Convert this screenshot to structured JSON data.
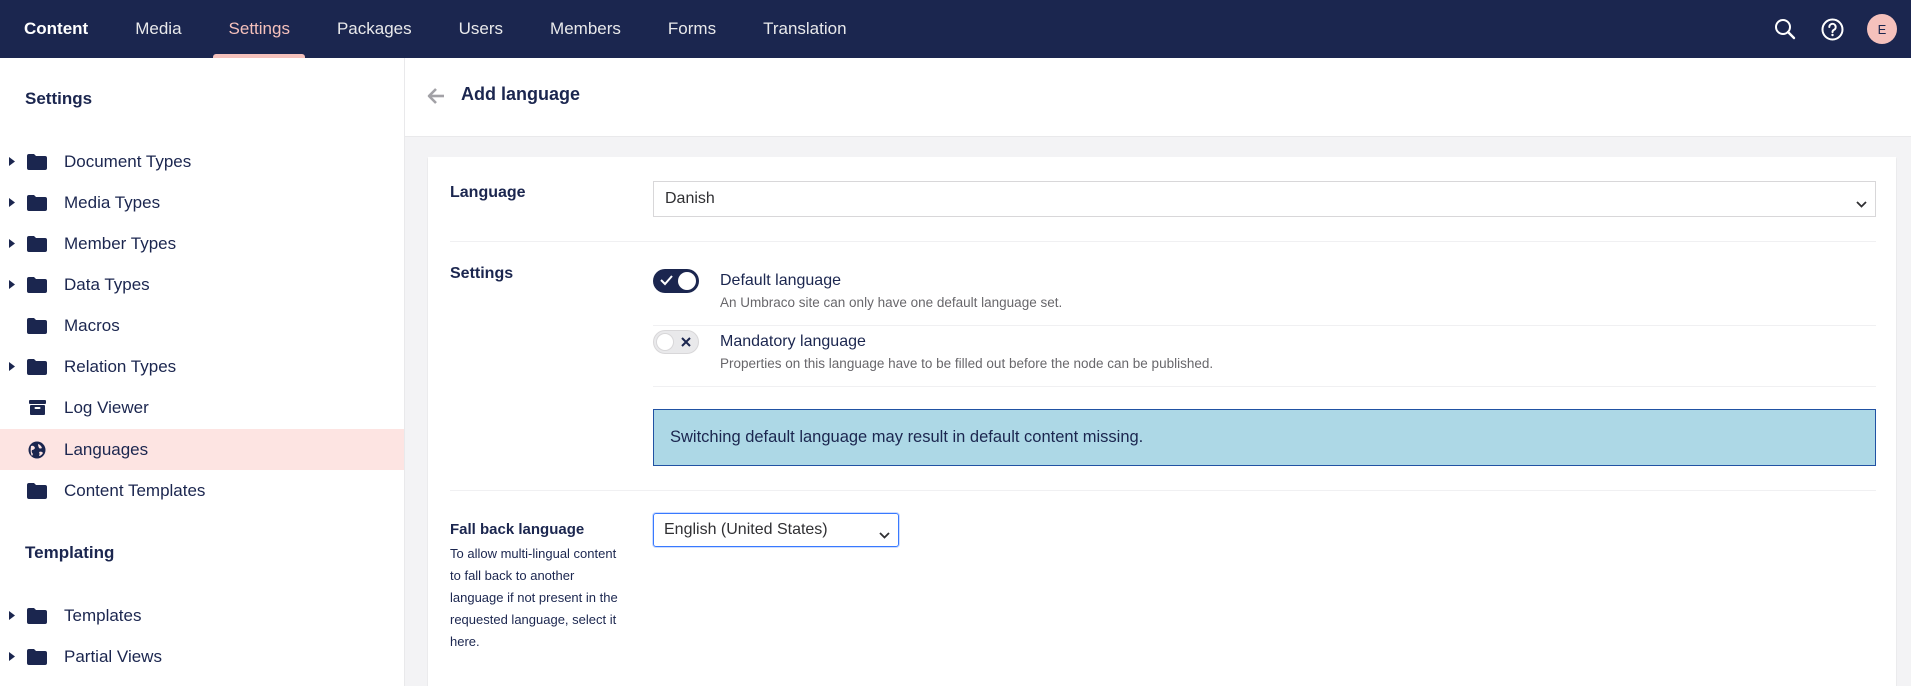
{
  "nav": {
    "items": [
      {
        "label": "Content"
      },
      {
        "label": "Media"
      },
      {
        "label": "Settings"
      },
      {
        "label": "Packages"
      },
      {
        "label": "Users"
      },
      {
        "label": "Members"
      },
      {
        "label": "Forms"
      },
      {
        "label": "Translation"
      }
    ],
    "active_index": 2,
    "active_color": "#f5c1bc",
    "brand_color": "#1b264f",
    "icons": [
      "search-icon",
      "help-icon"
    ],
    "avatar_initial": "E"
  },
  "sidebar": {
    "settings_heading": "Settings",
    "items": [
      {
        "label": "Document Types",
        "icon": "folder-icon",
        "expandable": true
      },
      {
        "label": "Media Types",
        "icon": "folder-icon",
        "expandable": true
      },
      {
        "label": "Member Types",
        "icon": "folder-icon",
        "expandable": true
      },
      {
        "label": "Data Types",
        "icon": "folder-icon",
        "expandable": true
      },
      {
        "label": "Macros",
        "icon": "folder-icon",
        "expandable": false
      },
      {
        "label": "Relation Types",
        "icon": "folder-icon",
        "expandable": true
      },
      {
        "label": "Log Viewer",
        "icon": "archive-box-icon",
        "expandable": false
      },
      {
        "label": "Languages",
        "icon": "globe-icon",
        "expandable": false,
        "active": true
      },
      {
        "label": "Content Templates",
        "icon": "folder-icon",
        "expandable": false
      }
    ],
    "templating_heading": "Templating",
    "templating_items": [
      {
        "label": "Templates",
        "icon": "folder-icon",
        "expandable": true
      },
      {
        "label": "Partial Views",
        "icon": "folder-icon",
        "expandable": true
      }
    ]
  },
  "header": {
    "title": "Add language"
  },
  "form": {
    "language": {
      "label": "Language",
      "value": "Danish"
    },
    "settings": {
      "label": "Settings",
      "default_language": {
        "title": "Default language",
        "description": "An Umbraco site can only have one default language set.",
        "enabled": true
      },
      "mandatory_language": {
        "title": "Mandatory language",
        "description": "Properties on this language have to be filled out before the node can be published.",
        "enabled": false
      },
      "alert": "Switching default language may result in default content missing."
    },
    "fallback": {
      "label": "Fall back language",
      "description": "To allow multi-lingual content to fall back to another language if not present in the requested language, select it here.",
      "value": "English (United States)"
    }
  }
}
